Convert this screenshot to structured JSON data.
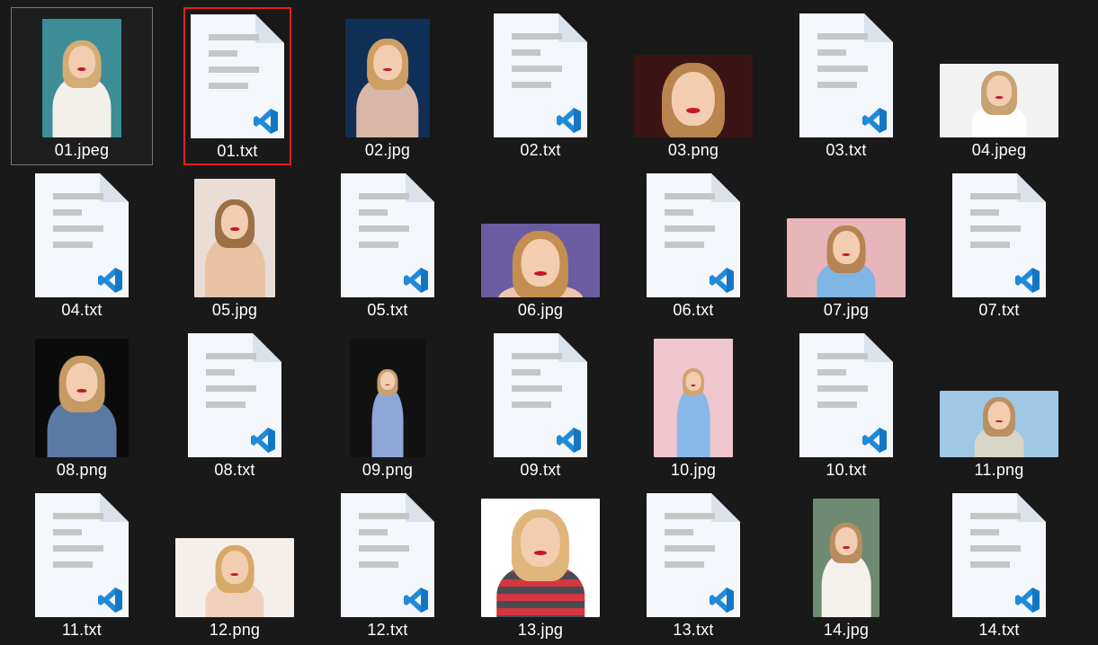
{
  "files": [
    {
      "name": "01.jpeg",
      "type": "photo",
      "w": 88,
      "h": 132,
      "bg": "#3c8d95",
      "hair": "#d5ac73",
      "body": "#f3efe9",
      "selected": true
    },
    {
      "name": "01.txt",
      "type": "doc",
      "highlighted": true
    },
    {
      "name": "02.jpg",
      "type": "photo",
      "w": 94,
      "h": 132,
      "bg": "#0f2f57",
      "hair": "#cf9e62",
      "body": "#d9b7a6"
    },
    {
      "name": "02.txt",
      "type": "doc"
    },
    {
      "name": "03.png",
      "type": "photo",
      "w": 132,
      "h": 92,
      "bg": "#3a1414",
      "hair": "#b9854e",
      "body": "#3a1414",
      "closeup": true
    },
    {
      "name": "03.txt",
      "type": "doc"
    },
    {
      "name": "04.jpeg",
      "type": "photo",
      "w": 132,
      "h": 82,
      "bg": "#f2f2f2",
      "hair": "#c9a274",
      "body": "#ffffff"
    },
    {
      "name": "04.txt",
      "type": "doc"
    },
    {
      "name": "05.jpg",
      "type": "photo",
      "w": 90,
      "h": 132,
      "bg": "#e9ddd6",
      "hair": "#9b7145",
      "body": "#e9c2a4"
    },
    {
      "name": "05.txt",
      "type": "doc"
    },
    {
      "name": "06.jpg",
      "type": "photo",
      "w": 132,
      "h": 82,
      "bg": "#6b5ca2",
      "hair": "#c48e51",
      "body": "#efc7b0",
      "closeup": true
    },
    {
      "name": "06.txt",
      "type": "doc"
    },
    {
      "name": "07.jpg",
      "type": "photo",
      "w": 132,
      "h": 88,
      "bg": "#e8b6b8",
      "hair": "#b68452",
      "body": "#7fb6e6"
    },
    {
      "name": "07.txt",
      "type": "doc"
    },
    {
      "name": "08.png",
      "type": "photo",
      "w": 104,
      "h": 132,
      "bg": "#0b0b0b",
      "hair": "#c59a63",
      "body": "#5b7aa3"
    },
    {
      "name": "08.txt",
      "type": "doc"
    },
    {
      "name": "09.png",
      "type": "photo",
      "w": 84,
      "h": 132,
      "bg": "#111111",
      "hair": "#c9a06e",
      "body": "#8ea6d8",
      "small": true
    },
    {
      "name": "09.txt",
      "type": "doc"
    },
    {
      "name": "10.jpg",
      "type": "photo",
      "w": 88,
      "h": 132,
      "bg": "#f0c6cf",
      "hair": "#d2a270",
      "body": "#87b8e8",
      "small": true
    },
    {
      "name": "10.txt",
      "type": "doc"
    },
    {
      "name": "11.png",
      "type": "photo",
      "w": 132,
      "h": 74,
      "bg": "#9fc8e4",
      "hair": "#b99063",
      "body": "#d8d6c7"
    },
    {
      "name": "11.txt",
      "type": "doc"
    },
    {
      "name": "12.png",
      "type": "photo",
      "w": 132,
      "h": 88,
      "bg": "#f4efeb",
      "hair": "#d7a968",
      "body": "#f1d0bb"
    },
    {
      "name": "12.txt",
      "type": "doc"
    },
    {
      "name": "13.jpg",
      "type": "photo",
      "w": 132,
      "h": 132,
      "bg": "#ffffff",
      "hair": "#e0b57b",
      "body": "#d5363f",
      "stripes": true
    },
    {
      "name": "13.txt",
      "type": "doc"
    },
    {
      "name": "14.jpg",
      "type": "photo",
      "w": 74,
      "h": 132,
      "bg": "#6f8a72",
      "hair": "#b98d5f",
      "body": "#f5f1ec"
    },
    {
      "name": "14.txt",
      "type": "doc"
    }
  ],
  "doc_icon": {
    "page": "#f3f6fa",
    "fold": "#dbe2ea",
    "lines": "#c6c6c6",
    "vscode_blue": "#1f8ad8",
    "vscode_dark": "#0a66b2"
  }
}
